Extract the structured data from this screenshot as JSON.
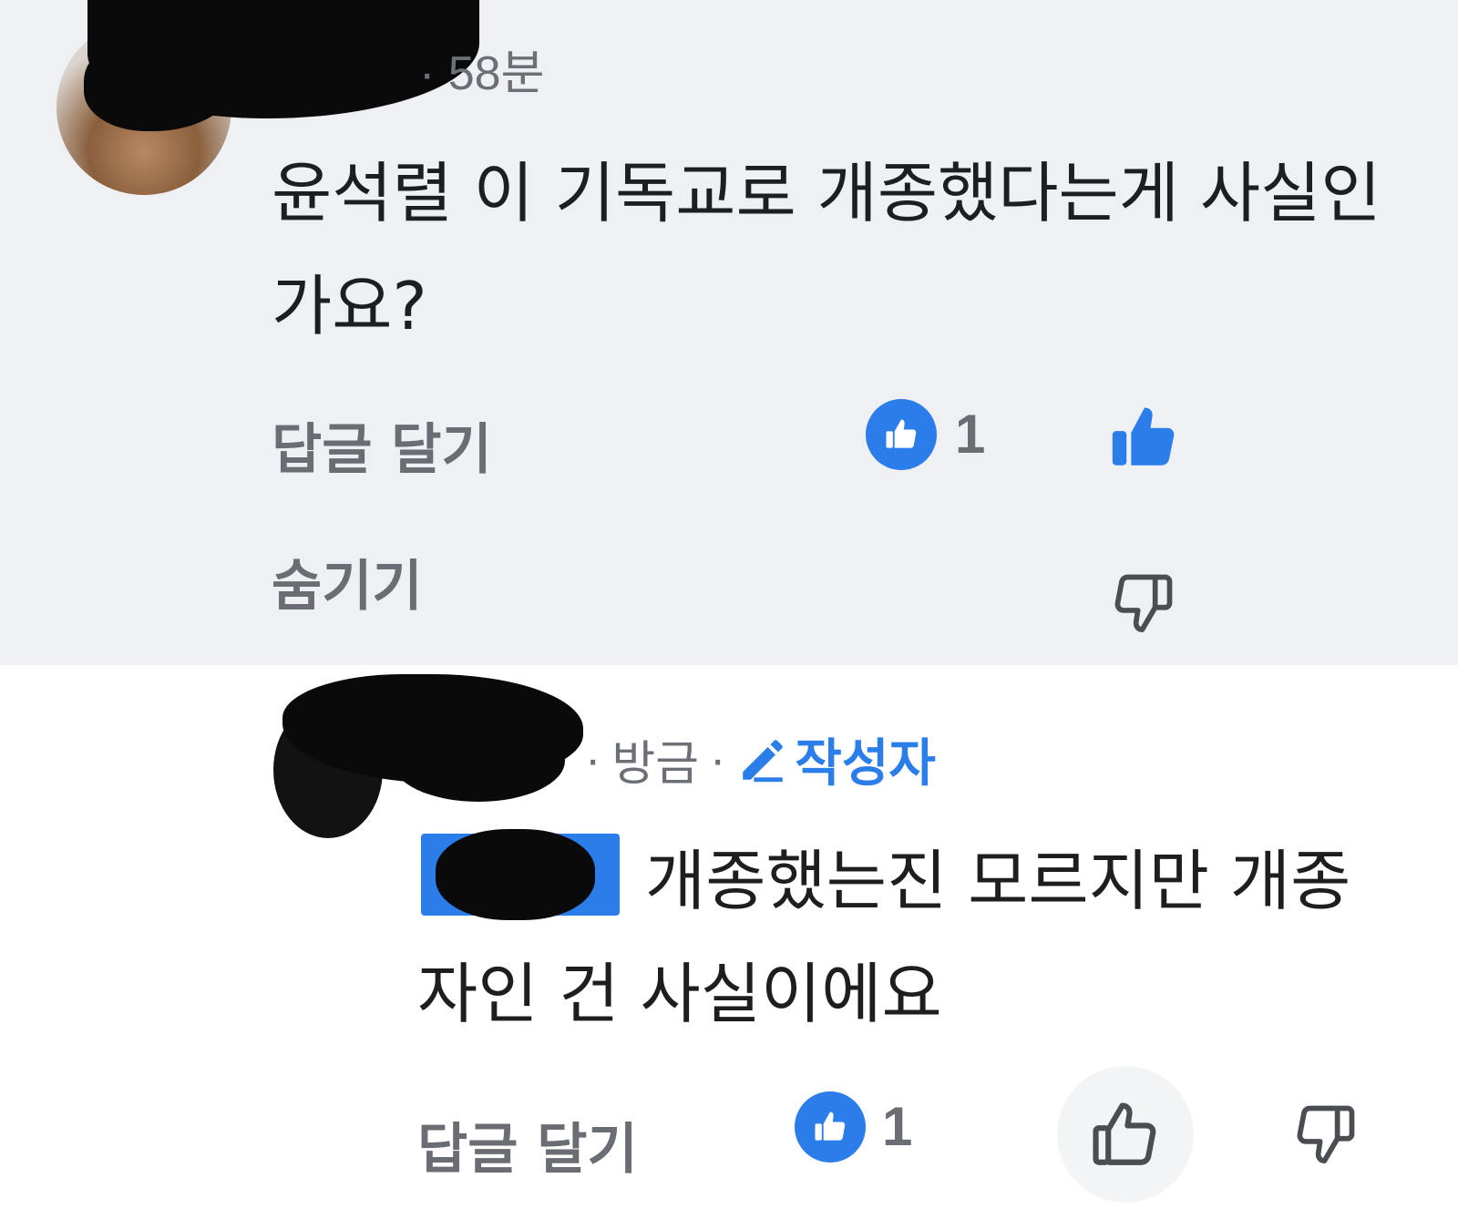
{
  "colors": {
    "accent": "#2b7de9",
    "comment_bg_highlight": "#eef0f4",
    "text_primary": "#1d1e20",
    "text_secondary": "#6a6d73"
  },
  "comments": [
    {
      "meta": "· 58분",
      "body": "윤석렬 이 기독교로 개종했다는게 사실인가요?",
      "reply_label": "답글 달기",
      "hide_label": "숨기기",
      "like_count": "1",
      "icons": [
        "thumbs-up-filled-icon",
        "thumbs-down-icon"
      ]
    },
    {
      "meta_time": "방금",
      "meta_dot": "·",
      "author_badge": "작성자",
      "body": "개종했는진 모르지만 개종자인 건 사실이에요",
      "reply_label": "답글 달기",
      "like_count": "1",
      "icons": [
        "thumbs-up-outline-icon",
        "thumbs-down-icon",
        "pencil-icon"
      ]
    }
  ]
}
